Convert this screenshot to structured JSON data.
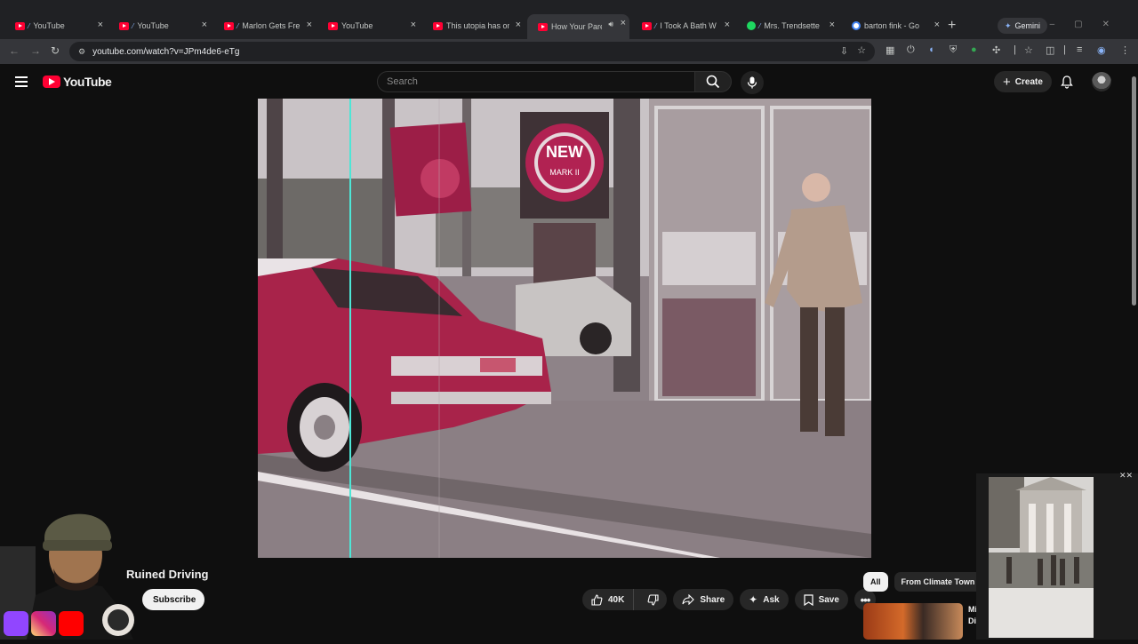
{
  "browser": {
    "tabs": [
      {
        "title": "YouTube",
        "icon": "youtube-icon",
        "pinned_icon": true
      },
      {
        "title": "YouTube",
        "icon": "youtube-icon",
        "pinned_icon": true
      },
      {
        "title": "Marlon Gets Fre",
        "icon": "youtube-icon",
        "pinned_icon": true
      },
      {
        "title": "YouTube",
        "icon": "youtube-icon",
        "pinned_icon": false
      },
      {
        "title": "This utopia has one",
        "icon": "youtube-icon",
        "pinned_icon": false
      },
      {
        "title": "How Your Paren",
        "icon": "youtube-icon",
        "pinned_icon": false,
        "active": true
      },
      {
        "title": "I Took A Bath W",
        "icon": "youtube-icon",
        "pinned_icon": true
      },
      {
        "title": "Mrs. Trendsette",
        "icon": "spotify-icon",
        "pinned_icon": true
      },
      {
        "title": "barton fink - Go",
        "icon": "google-icon",
        "pinned_icon": false
      }
    ],
    "gemini_label": "Gemini",
    "url": "youtube.com/watch?v=JPm4de6-eTg"
  },
  "youtube": {
    "logo_text": "YouTube",
    "search_placeholder": "Search",
    "create_label": "Create"
  },
  "video": {
    "title": "Ruined Driving",
    "subscribe_label": "Subscribe",
    "like_count": "40K",
    "share_label": "Share",
    "ask_label": "Ask",
    "save_label": "Save"
  },
  "recommendations": {
    "chips": [
      "All",
      "From Climate Town"
    ],
    "first_title": "Mi\nDi"
  },
  "colors": {
    "youtube_red": "#ff0033",
    "background": "#0f0f0f",
    "pill": "#272727"
  }
}
